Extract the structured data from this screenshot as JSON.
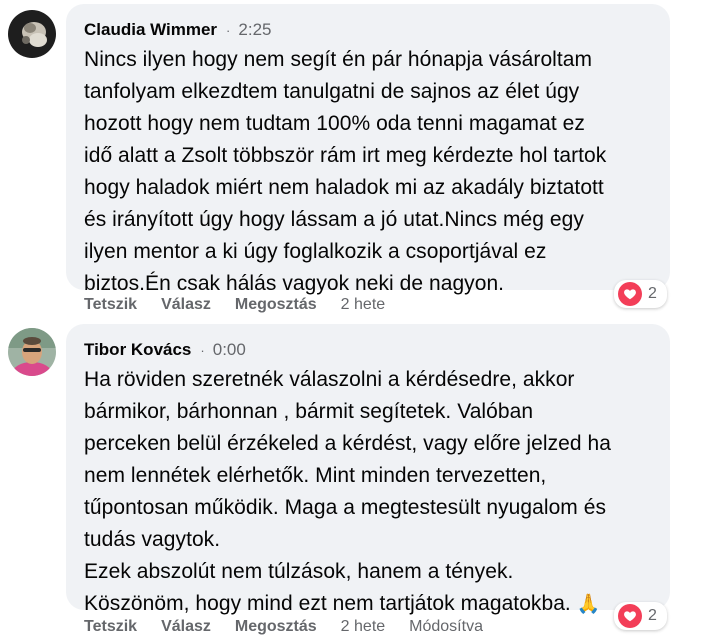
{
  "comments": [
    {
      "author": "Claudia Wimmer",
      "time": "2:25",
      "text": "Nincs ilyen hogy nem segít én pár hónapja vásároltam\ntanfolyam elkezdtem tanulgatni de sajnos az élet úgy\nhozott hogy nem tudtam 100% oda tenni magamat ez\nidő alatt a Zsolt többször rám irt meg kérdezte hol tartok\nhogy haladok miért nem haladok mi az akadály biztatott\nés irányított úgy hogy lássam a jó utat.Nincs még egy\nilyen mentor a ki úgy foglalkozik a csoportjával ez\nbiztos.Én csak hálás vagyok neki de nagyon.",
      "reaction_icon": "heart-icon",
      "reaction_count": "2",
      "actions": {
        "like": "Tetszik",
        "reply": "Válasz",
        "share": "Megosztás"
      },
      "age": "2 hete"
    },
    {
      "author": "Tibor Kovács",
      "time": "0:00",
      "text": "Ha röviden szeretnék válaszolni a kérdésedre, akkor\nbármikor, bárhonnan , bármit segítetek. Valóban\nperceken belül érzékeled a kérdést, vagy előre jelzed ha\nnem lennétek elérhetők. Mint minden tervezetten,\ntűpontosan működik. Maga a megtestesült nyugalom és\ntudás vagytok.\nEzek abszolút nem túlzások, hanem a tények.\nKöszönöm, hogy mind ezt nem tartjátok magatokba.",
      "emoji": "🙏",
      "reaction_icon": "heart-icon",
      "reaction_count": "2",
      "actions": {
        "like": "Tetszik",
        "reply": "Válasz",
        "share": "Megosztás"
      },
      "age": "2 hete",
      "edited": "Módosítva"
    }
  ],
  "colors": {
    "bubble": "#f0f2f5",
    "meta_text": "#65676b",
    "heart": "#f33e58"
  }
}
